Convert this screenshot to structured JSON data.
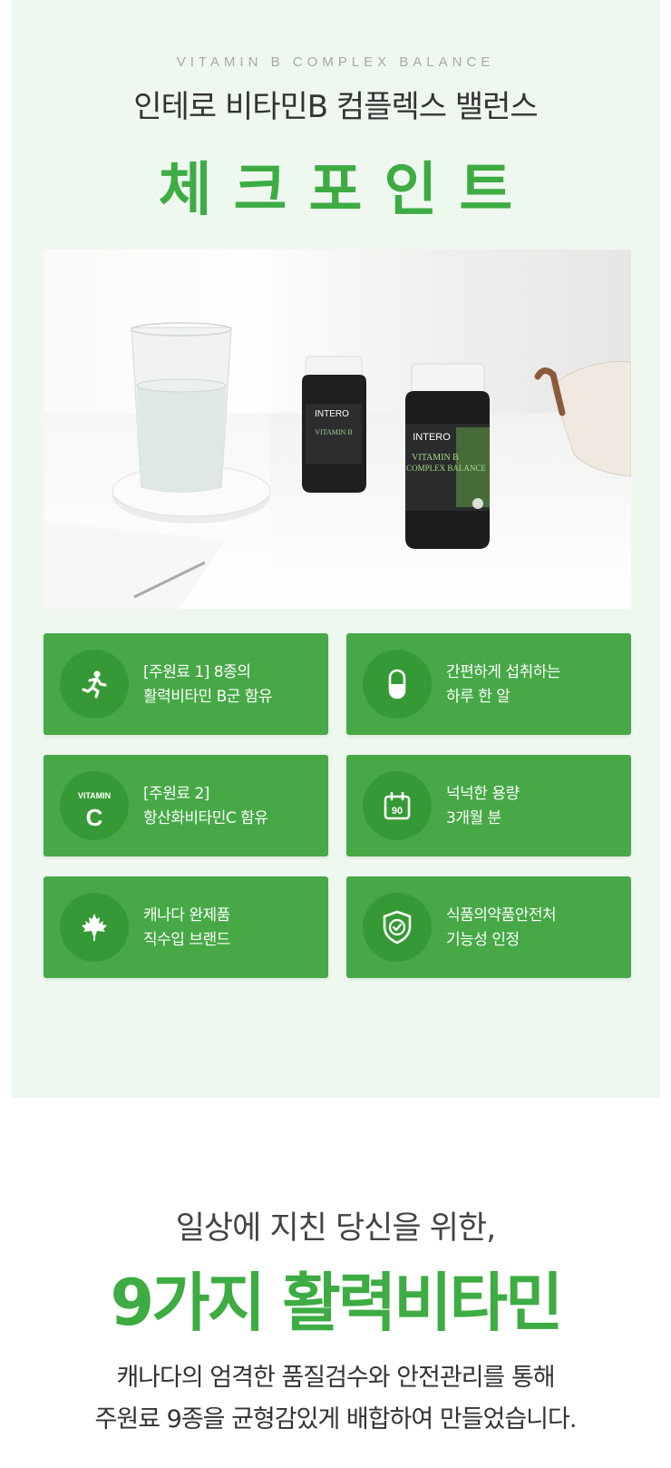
{
  "header": {
    "eyebrow": "VITAMIN B COMPLEX BALANCE",
    "headline": "인테로 비타민B 컴플렉스 밸런스",
    "title": "체크포인트"
  },
  "photo": {
    "bottle_brand": "INTERO",
    "bottle_label_1": "VITAMIN B",
    "bottle_label_2": "COMPLEX BALANCE"
  },
  "features": [
    {
      "icon": "running-person-icon",
      "line1": "[주원료 1] 8종의",
      "line2": "활력비타민 B군 함유"
    },
    {
      "icon": "capsule-icon",
      "line1": "간편하게 섭취하는",
      "line2": "하루 한 알"
    },
    {
      "icon": "vitamin-c-icon",
      "icon_label": "VITAMIN",
      "icon_letter": "C",
      "line1": "[주원료 2]",
      "line2": "항산화비타민C 함유"
    },
    {
      "icon": "calendar-icon",
      "icon_number": "90",
      "line1": "넉넉한 용량",
      "line2": "3개월 분"
    },
    {
      "icon": "maple-leaf-icon",
      "line1": "캐나다 완제품",
      "line2": "직수입 브랜드"
    },
    {
      "icon": "shield-check-icon",
      "line1": "식품의약품안전처",
      "line2": "기능성 인정"
    }
  ],
  "section2": {
    "subhead": "일상에 지친 당신을 위한,",
    "title": "9가지 활력비타민",
    "desc_line1": "캐나다의 엄격한 품질검수와 안전관리를 통해",
    "desc_line2": "주원료 9종을 균형감있게 배합하여 만들었습니다."
  },
  "colors": {
    "accent": "#3dac42",
    "card": "#46a946",
    "card_circle": "#359a35",
    "section_bg": "#eff8ef"
  }
}
